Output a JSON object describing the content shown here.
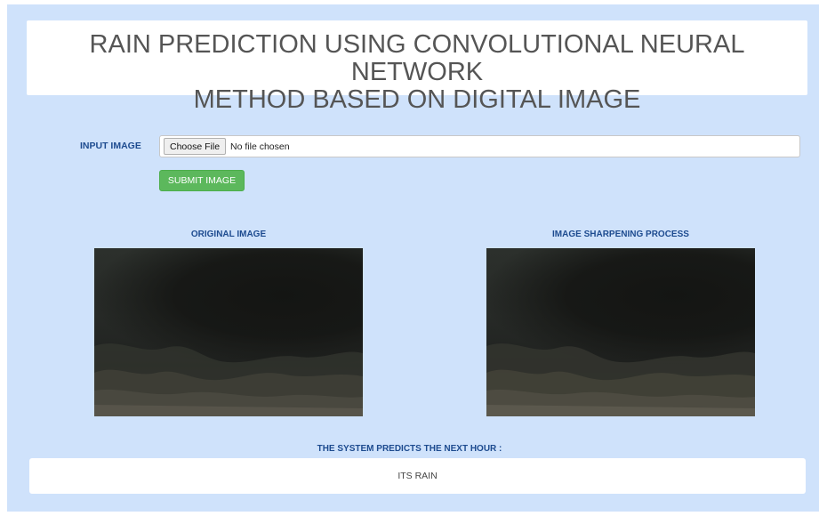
{
  "header": {
    "title_line1": "RAIN PREDICTION USING CONVOLUTIONAL NEURAL NETWORK",
    "title_line2": "METHOD BASED ON DIGITAL IMAGE"
  },
  "form": {
    "input_label": "INPUT IMAGE",
    "choose_button_label": "Choose File",
    "file_status": "No file chosen",
    "submit_label": "SUBMIT IMAGE"
  },
  "images": {
    "original_caption": "ORIGINAL IMAGE",
    "sharpened_caption": "IMAGE SHARPENING PROCESS"
  },
  "prediction": {
    "label": "THE SYSTEM PREDICTS THE NEXT HOUR :",
    "result": "ITS RAIN"
  },
  "colors": {
    "background": "#cfe2fb",
    "accent_text": "#1d4b8f",
    "submit_green": "#5cb85c"
  }
}
